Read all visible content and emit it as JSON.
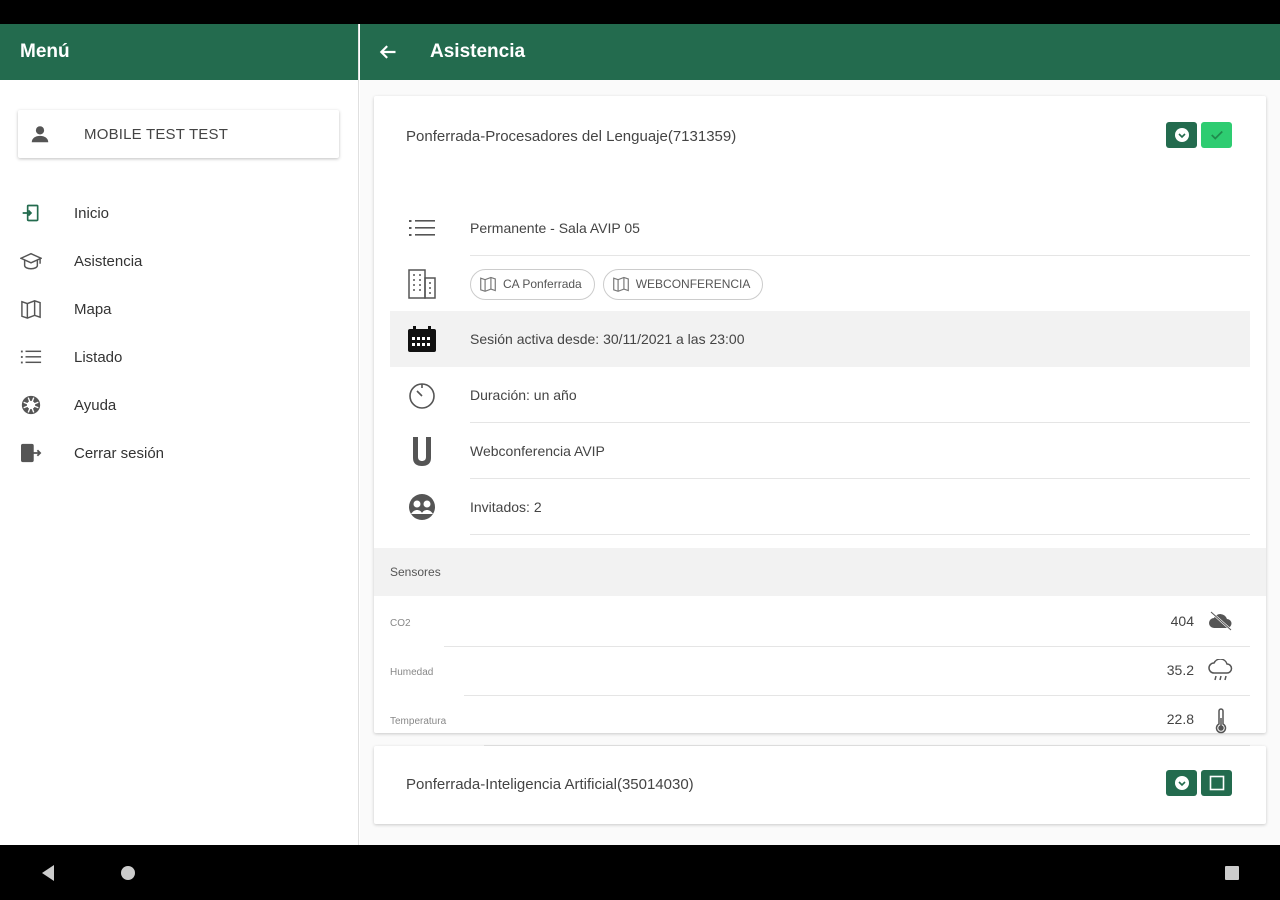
{
  "sidebar": {
    "title": "Menú",
    "user_name": "MOBILE TEST TEST",
    "items": [
      {
        "label": "Inicio",
        "icon": "login-icon"
      },
      {
        "label": "Asistencia",
        "icon": "school-icon"
      },
      {
        "label": "Mapa",
        "icon": "map-icon"
      },
      {
        "label": "Listado",
        "icon": "list-icon"
      },
      {
        "label": "Ayuda",
        "icon": "lifebuoy-icon"
      },
      {
        "label": "Cerrar sesión",
        "icon": "logout-icon"
      }
    ]
  },
  "header": {
    "title": "Asistencia"
  },
  "session_card": {
    "title": "Ponferrada-Procesadores del Lenguaje(7131359)",
    "type": "Permanente - Sala AVIP 05",
    "chips": [
      "CA Ponferrada",
      "WEBCONFERENCIA"
    ],
    "active_since": "Sesión activa desde: 30/11/2021 a las 23:00",
    "duration": "Duración: un año",
    "platform": "Webconferencia AVIP",
    "guests": "Invitados: 2",
    "sensors_title": "Sensores",
    "sensors": [
      {
        "label": "CO2",
        "value": "404",
        "icon": "cloud-off-icon"
      },
      {
        "label": "Humedad",
        "value": "35.2",
        "icon": "weather-rain-icon"
      },
      {
        "label": "Temperatura",
        "value": "22.8",
        "icon": "thermometer-icon"
      }
    ]
  },
  "second_card": {
    "title": "Ponferrada-Inteligencia Artificial(35014030)"
  },
  "colors": {
    "primary": "#236b4e",
    "accent_green": "#2ecc71"
  }
}
